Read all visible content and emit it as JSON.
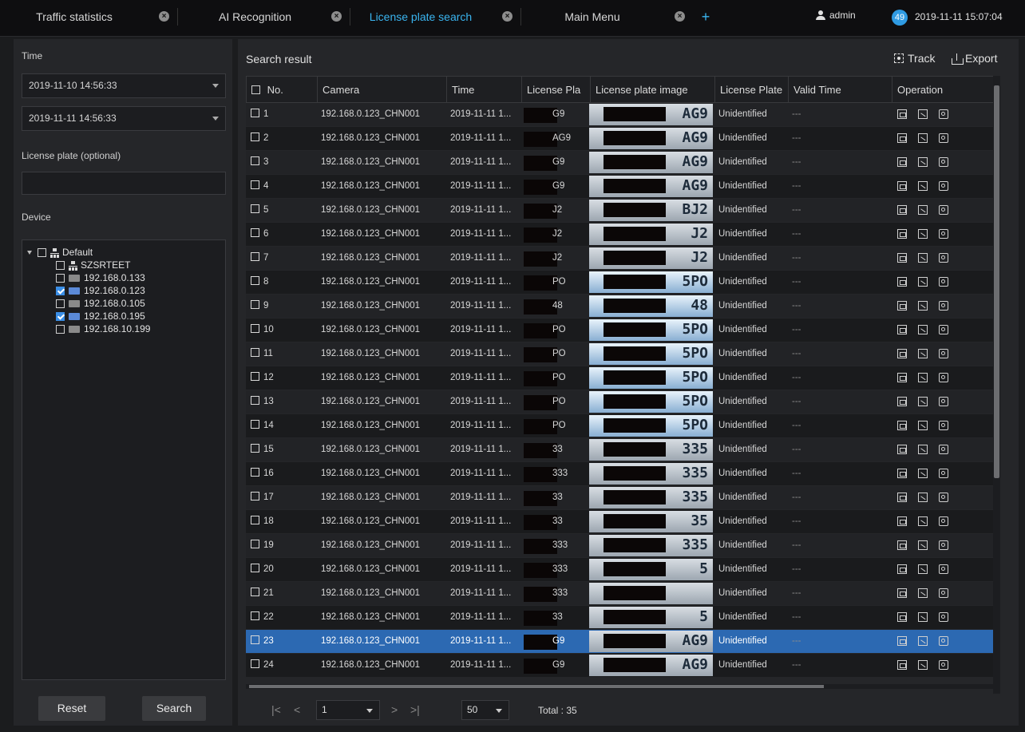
{
  "tabs": [
    {
      "label": "Traffic statistics",
      "active": false
    },
    {
      "label": "AI Recognition",
      "active": false
    },
    {
      "label": "License plate search",
      "active": true
    },
    {
      "label": "Main Menu",
      "active": false
    }
  ],
  "header": {
    "user": "admin",
    "badge": "49",
    "datetime": "2019-11-11 15:07:04",
    "add_label": "+"
  },
  "left": {
    "time_label": "Time",
    "start_time": "2019-11-10 14:56:33",
    "end_time": "2019-11-11 14:56:33",
    "plate_label": "License plate (optional)",
    "plate_value": "",
    "device_label": "Device",
    "tree": [
      {
        "label": "Default",
        "level": 0,
        "icon": "network-icon",
        "checked": false,
        "expander": true
      },
      {
        "label": "SZSRTEET",
        "level": 1,
        "icon": "network-icon",
        "checked": false
      },
      {
        "label": "192.168.0.133",
        "level": 1,
        "icon": "camera-icon",
        "checked": false
      },
      {
        "label": "192.168.0.123",
        "level": 1,
        "icon": "camera-icon",
        "checked": true
      },
      {
        "label": "192.168.0.105",
        "level": 1,
        "icon": "camera-icon",
        "checked": false
      },
      {
        "label": "192.168.0.195",
        "level": 1,
        "icon": "camera-icon",
        "checked": true
      },
      {
        "label": "192.168.10.199",
        "level": 1,
        "icon": "camera-icon",
        "checked": false
      }
    ],
    "reset_label": "Reset",
    "search_label": "Search"
  },
  "main": {
    "title": "Search result",
    "track_label": "Track",
    "export_label": "Export",
    "columns": [
      "No.",
      "Camera",
      "Time",
      "License Pla",
      "License plate image",
      "License Plate",
      "Valid Time",
      "Operation"
    ],
    "rows": [
      {
        "no": "1",
        "camera": "192.168.0.123_CHN001",
        "time": "2019-11-11 1...",
        "plate": "G9",
        "img": "AG9",
        "type": "Unidentified",
        "valid": "---"
      },
      {
        "no": "2",
        "camera": "192.168.0.123_CHN001",
        "time": "2019-11-11 1...",
        "plate": "AG9",
        "img": "AG9",
        "type": "Unidentified",
        "valid": "---"
      },
      {
        "no": "3",
        "camera": "192.168.0.123_CHN001",
        "time": "2019-11-11 1...",
        "plate": "G9",
        "img": "AG9",
        "type": "Unidentified",
        "valid": "---"
      },
      {
        "no": "4",
        "camera": "192.168.0.123_CHN001",
        "time": "2019-11-11 1...",
        "plate": "G9",
        "img": "AG9",
        "type": "Unidentified",
        "valid": "---"
      },
      {
        "no": "5",
        "camera": "192.168.0.123_CHN001",
        "time": "2019-11-11 1...",
        "plate": "J2",
        "img": "BJ2",
        "type": "Unidentified",
        "valid": "---"
      },
      {
        "no": "6",
        "camera": "192.168.0.123_CHN001",
        "time": "2019-11-11 1...",
        "plate": "J2",
        "img": "J2",
        "type": "Unidentified",
        "valid": "---"
      },
      {
        "no": "7",
        "camera": "192.168.0.123_CHN001",
        "time": "2019-11-11 1...",
        "plate": "J2",
        "img": "J2",
        "type": "Unidentified",
        "valid": "---"
      },
      {
        "no": "8",
        "camera": "192.168.0.123_CHN001",
        "time": "2019-11-11 1...",
        "plate": "PO",
        "img": "5PO",
        "type": "Unidentified",
        "valid": "---"
      },
      {
        "no": "9",
        "camera": "192.168.0.123_CHN001",
        "time": "2019-11-11 1...",
        "plate": "48",
        "img": "48",
        "type": "Unidentified",
        "valid": "---"
      },
      {
        "no": "10",
        "camera": "192.168.0.123_CHN001",
        "time": "2019-11-11 1...",
        "plate": "PO",
        "img": "5PO",
        "type": "Unidentified",
        "valid": "---"
      },
      {
        "no": "11",
        "camera": "192.168.0.123_CHN001",
        "time": "2019-11-11 1...",
        "plate": "PO",
        "img": "5PO",
        "type": "Unidentified",
        "valid": "---"
      },
      {
        "no": "12",
        "camera": "192.168.0.123_CHN001",
        "time": "2019-11-11 1...",
        "plate": "PO",
        "img": "5PO",
        "type": "Unidentified",
        "valid": "---"
      },
      {
        "no": "13",
        "camera": "192.168.0.123_CHN001",
        "time": "2019-11-11 1...",
        "plate": "PO",
        "img": "5PO",
        "type": "Unidentified",
        "valid": "---"
      },
      {
        "no": "14",
        "camera": "192.168.0.123_CHN001",
        "time": "2019-11-11 1...",
        "plate": "PO",
        "img": "5PO",
        "type": "Unidentified",
        "valid": "---"
      },
      {
        "no": "15",
        "camera": "192.168.0.123_CHN001",
        "time": "2019-11-11 1...",
        "plate": "33",
        "img": "335",
        "type": "Unidentified",
        "valid": "---"
      },
      {
        "no": "16",
        "camera": "192.168.0.123_CHN001",
        "time": "2019-11-11 1...",
        "plate": "333",
        "img": "335",
        "type": "Unidentified",
        "valid": "---"
      },
      {
        "no": "17",
        "camera": "192.168.0.123_CHN001",
        "time": "2019-11-11 1...",
        "plate": "33",
        "img": "335",
        "type": "Unidentified",
        "valid": "---"
      },
      {
        "no": "18",
        "camera": "192.168.0.123_CHN001",
        "time": "2019-11-11 1...",
        "plate": "33",
        "img": "35",
        "type": "Unidentified",
        "valid": "---"
      },
      {
        "no": "19",
        "camera": "192.168.0.123_CHN001",
        "time": "2019-11-11 1...",
        "plate": "333",
        "img": "335",
        "type": "Unidentified",
        "valid": "---"
      },
      {
        "no": "20",
        "camera": "192.168.0.123_CHN001",
        "time": "2019-11-11 1...",
        "plate": "333",
        "img": "5",
        "type": "Unidentified",
        "valid": "---"
      },
      {
        "no": "21",
        "camera": "192.168.0.123_CHN001",
        "time": "2019-11-11 1...",
        "plate": "333",
        "img": "",
        "type": "Unidentified",
        "valid": "---"
      },
      {
        "no": "22",
        "camera": "192.168.0.123_CHN001",
        "time": "2019-11-11 1...",
        "plate": "33",
        "img": "5",
        "type": "Unidentified",
        "valid": "---"
      },
      {
        "no": "23",
        "camera": "192.168.0.123_CHN001",
        "time": "2019-11-11 1...",
        "plate": "G9",
        "img": "AG9",
        "type": "Unidentified",
        "valid": "---",
        "selected": true
      },
      {
        "no": "24",
        "camera": "192.168.0.123_CHN001",
        "time": "2019-11-11 1...",
        "plate": "G9",
        "img": "AG9",
        "type": "Unidentified",
        "valid": "---"
      }
    ],
    "pager": {
      "page": "1",
      "page_size": "50",
      "total": "Total : 35"
    }
  },
  "colors": {
    "accent": "#3ab4ef",
    "selected_row": "#2c69b2",
    "panel": "#252629",
    "background": "#1b1c1e"
  }
}
